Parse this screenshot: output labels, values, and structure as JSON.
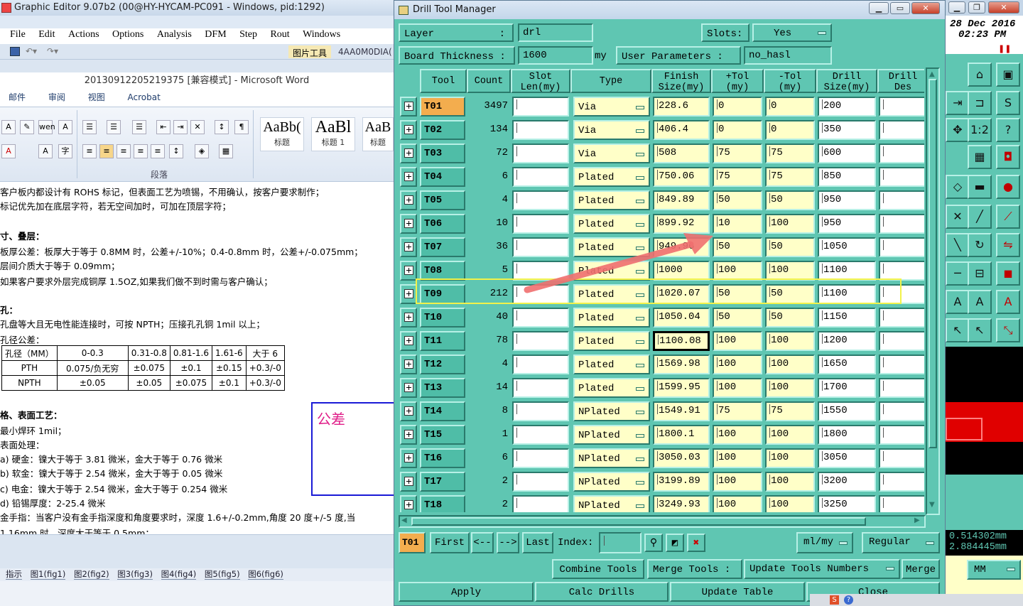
{
  "editor": {
    "title": "Graphic Editor 9.07b2 (00@HY-HYCAM-PC091 - Windows, pid:1292)",
    "menu": [
      "File",
      "Edit",
      "Actions",
      "Options",
      "Analysis",
      "DFM",
      "Step",
      "Rout",
      "Windows"
    ]
  },
  "word": {
    "pic_tool": "图片工具",
    "doc_code": "4AA0M0DIA(",
    "title": "20130912205219375 [兼容模式] - Microsoft Word",
    "tabs": [
      "邮件",
      "审阅",
      "视图",
      "Acrobat"
    ],
    "styles": [
      {
        "preview": "AaBb(",
        "name": "标题"
      },
      {
        "preview": "AaBl",
        "name": "标题 1"
      },
      {
        "preview": "AaB",
        "name": "标题"
      }
    ],
    "paragraph_group": "段落",
    "lines": [
      "客户板内都设计有 ROHS 标记，但表面工艺为喷锡，不用确认，按客户要求制作；",
      "标记优先加在底层字符，若无空间加时，可加在顶层字符；",
      "寸、叠层：",
      "板厚公差：板厚大于等于 0.8MM 时，公差+/-10%；0.4-0.8mm 时，公差+/-0.075mm；",
      "层间介质大于等于 0.09mm；",
      "如果客户要求外层完成铜厚 1.5OZ,如果我们做不到时需与客户确认；",
      "孔：",
      "孔盘等大且无电性能连接时，可按 NPTH；压接孔孔铜 1mil 以上；",
      "孔径公差："
    ],
    "tolerance_table": [
      [
        "孔径（MM）",
        "0-0.3",
        "0.31-0.8",
        "0.81-1.6",
        "1.61-6",
        "大于 6"
      ],
      [
        "PTH",
        "0.075/负无穷",
        "±0.075",
        "±0.1",
        "±0.15",
        "+0.3/-0"
      ],
      [
        "NPTH",
        "±0.05",
        "±0.05",
        "±0.075",
        "±0.1",
        "+0.3/-0"
      ]
    ],
    "lines2": [
      "格、表面工艺：",
      "最小焊环 1mil；",
      "表面处理：",
      "a) 硬金：镍大于等于 3.81 微米，金大于等于 0.76 微米",
      "b) 软金：镍大于等于 2.54 微米，金大于等于 0.05 微米",
      "c) 电金：镍大于等于 2.54 微米，金大于等于 0.254 微米",
      "d) 铅锡厚度：2-25.4 微米",
      "金手指：当客户没有金手指深度和角度要求时，深度 1.6+/-0.2mm,角度 20 度+/-5 度,当",
      "1.16mm 时，深度大于等于 0.5mm；"
    ],
    "annotation": "公差",
    "sheet_tabs": [
      "指示",
      "图1(fig1)",
      "图2(fig2)",
      "图3(fig3)",
      "图4(fig4)",
      "图5(fig5)",
      "图6(fig6)"
    ]
  },
  "dtm": {
    "title": "Drill Tool Manager",
    "layer_label": "Layer",
    "layer_value": "drl",
    "slots_label": "Slots:",
    "slots_value": "Yes",
    "thickness_label": "Board Thickness :",
    "thickness_value": "1600",
    "thickness_unit": "my",
    "user_params_label": "User Parameters :",
    "user_params_value": "no_hasl",
    "headers": [
      "Tool",
      "Count",
      "Slot\nLen(my)",
      "Type",
      "Finish\nSize(my)",
      "+Tol\n(my)",
      "-Tol\n(my)",
      "Drill\nSize(my)",
      "Drill\nDes"
    ],
    "rows": [
      {
        "tool": "T01",
        "count": "3497",
        "type": "Via",
        "finish": "228.6",
        "ptol": "0",
        "mtol": "0",
        "drill": "200"
      },
      {
        "tool": "T02",
        "count": "134",
        "type": "Via",
        "finish": "406.4",
        "ptol": "0",
        "mtol": "0",
        "drill": "350"
      },
      {
        "tool": "T03",
        "count": "72",
        "type": "Via",
        "finish": "508",
        "ptol": "75",
        "mtol": "75",
        "drill": "600"
      },
      {
        "tool": "T04",
        "count": "6",
        "type": "Plated",
        "finish": "750.06",
        "ptol": "75",
        "mtol": "75",
        "drill": "850"
      },
      {
        "tool": "T05",
        "count": "4",
        "type": "Plated",
        "finish": "849.89",
        "ptol": "50",
        "mtol": "50",
        "drill": "950"
      },
      {
        "tool": "T06",
        "count": "10",
        "type": "Plated",
        "finish": "899.92",
        "ptol": "10",
        "mtol": "100",
        "drill": "950"
      },
      {
        "tool": "T07",
        "count": "36",
        "type": "Plated",
        "finish": "949.96",
        "ptol": "50",
        "mtol": "50",
        "drill": "1050"
      },
      {
        "tool": "T08",
        "count": "5",
        "type": "Plated",
        "finish": "1000",
        "ptol": "100",
        "mtol": "100",
        "drill": "1100"
      },
      {
        "tool": "T09",
        "count": "212",
        "type": "Plated",
        "finish": "1020.07",
        "ptol": "50",
        "mtol": "50",
        "drill": "1100"
      },
      {
        "tool": "T10",
        "count": "40",
        "type": "Plated",
        "finish": "1050.04",
        "ptol": "50",
        "mtol": "50",
        "drill": "1150"
      },
      {
        "tool": "T11",
        "count": "78",
        "type": "Plated",
        "finish": "1100.08",
        "ptol": "100",
        "mtol": "100",
        "drill": "1200"
      },
      {
        "tool": "T12",
        "count": "4",
        "type": "Plated",
        "finish": "1569.98",
        "ptol": "100",
        "mtol": "100",
        "drill": "1650"
      },
      {
        "tool": "T13",
        "count": "14",
        "type": "Plated",
        "finish": "1599.95",
        "ptol": "100",
        "mtol": "100",
        "drill": "1700"
      },
      {
        "tool": "T14",
        "count": "8",
        "type": "NPlated",
        "finish": "1549.91",
        "ptol": "75",
        "mtol": "75",
        "drill": "1550"
      },
      {
        "tool": "T15",
        "count": "1",
        "type": "NPlated",
        "finish": "1800.1",
        "ptol": "100",
        "mtol": "100",
        "drill": "1800"
      },
      {
        "tool": "T16",
        "count": "6",
        "type": "NPlated",
        "finish": "3050.03",
        "ptol": "100",
        "mtol": "100",
        "drill": "3050"
      },
      {
        "tool": "T17",
        "count": "2",
        "type": "NPlated",
        "finish": "3199.89",
        "ptol": "100",
        "mtol": "100",
        "drill": "3200"
      },
      {
        "tool": "T18",
        "count": "2",
        "type": "NPlated",
        "finish": "3249.93",
        "ptol": "100",
        "mtol": "100",
        "drill": "3250"
      }
    ],
    "current_tool": "T01",
    "nav": {
      "first": "First",
      "prev": "<--",
      "next": "-->",
      "last": "Last",
      "index_label": "Index:"
    },
    "units": "ml/my",
    "mode": "Regular",
    "actions": {
      "combine": "Combine Tools",
      "merge_label": "Merge Tools :",
      "update_numbers": "Update Tools Numbers",
      "merge": "Merge"
    },
    "footer": {
      "apply": "Apply",
      "calc": "Calc Drills",
      "update": "Update Table",
      "close": "Close"
    }
  },
  "right_panel": {
    "date": "28 Dec 2016",
    "time": "02:23 PM",
    "coord_x": "0.514302mm",
    "coord_y": "2.884445mm",
    "unit": "MM"
  }
}
